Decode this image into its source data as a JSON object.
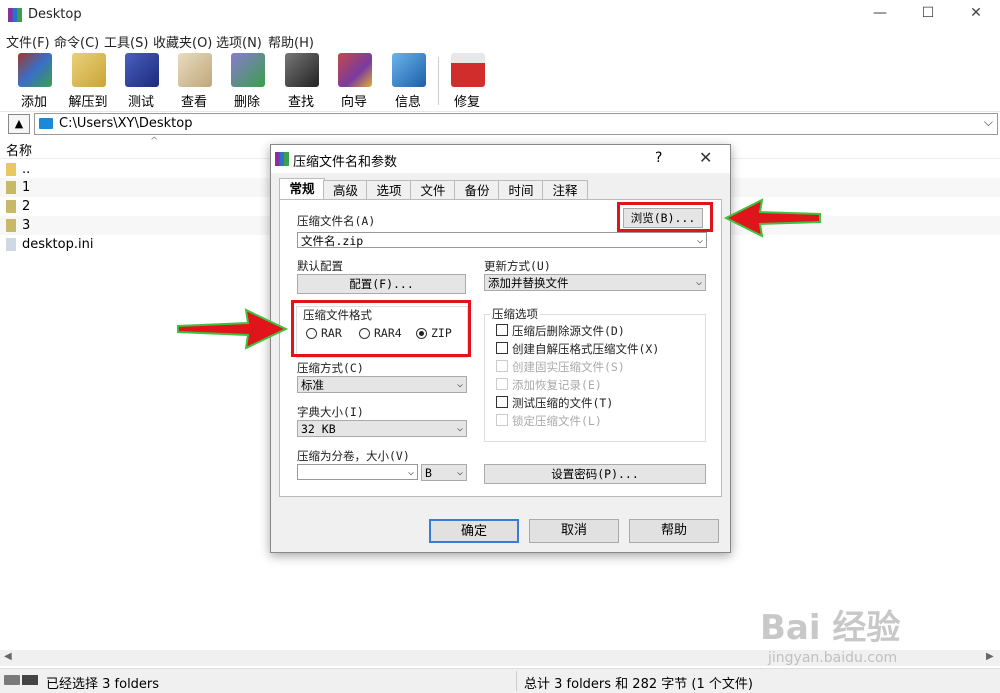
{
  "window": {
    "title": "Desktop",
    "min": "—",
    "max": "☐",
    "close": "✕"
  },
  "menu": [
    "文件(F)",
    "命令(C)",
    "工具(S)",
    "收藏夹(O)",
    "选项(N)",
    "帮助(H)"
  ],
  "toolbar": [
    {
      "label": "添加",
      "icon": "add-archive-icon",
      "color": "#9b3b2a"
    },
    {
      "label": "解压到",
      "icon": "extract-to-icon",
      "color": "#c9a535"
    },
    {
      "label": "测试",
      "icon": "test-icon",
      "color": "#2b3c9a"
    },
    {
      "label": "查看",
      "icon": "view-icon",
      "color": "#bfa77a"
    },
    {
      "label": "删除",
      "icon": "delete-icon",
      "color": "#6a5aa8"
    },
    {
      "label": "查找",
      "icon": "find-icon",
      "color": "#3b3b3b"
    },
    {
      "label": "向导",
      "icon": "wizard-icon",
      "color": "#7a3aa0"
    },
    {
      "label": "信息",
      "icon": "info-icon",
      "color": "#2e7ec8"
    },
    {
      "label": "修复",
      "icon": "repair-icon",
      "color": "#d22d2d"
    }
  ],
  "address": {
    "path": "C:\\Users\\XY\\Desktop"
  },
  "filelist": {
    "column_name": "名称",
    "items": [
      "..",
      "1",
      "2",
      "3",
      "desktop.ini"
    ]
  },
  "status": {
    "left": "已经选择 3 folders",
    "right": "总计 3 folders 和 282 字节 (1 个文件)"
  },
  "dialog": {
    "title": "压缩文件名和参数",
    "help": "?",
    "close": "✕",
    "tabs": [
      "常规",
      "高级",
      "选项",
      "文件",
      "备份",
      "时间",
      "注释"
    ],
    "archive_name_label": "压缩文件名(A)",
    "archive_name_value": "文件名.zip",
    "browse_button": "浏览(B)...",
    "default_profile_label": "默认配置",
    "profile_button": "配置(F)...",
    "update_mode_label": "更新方式(U)",
    "update_mode_value": "添加并替换文件",
    "format_label": "压缩文件格式",
    "formats": [
      "RAR",
      "RAR4",
      "ZIP"
    ],
    "selected_format": "ZIP",
    "options_label": "压缩选项",
    "options": [
      {
        "label": "压缩后删除源文件(D)",
        "enabled": true
      },
      {
        "label": "创建自解压格式压缩文件(X)",
        "enabled": true
      },
      {
        "label": "创建固实压缩文件(S)",
        "enabled": false
      },
      {
        "label": "添加恢复记录(E)",
        "enabled": false
      },
      {
        "label": "测试压缩的文件(T)",
        "enabled": true
      },
      {
        "label": "锁定压缩文件(L)",
        "enabled": false
      }
    ],
    "method_label": "压缩方式(C)",
    "method_value": "标准",
    "dict_label": "字典大小(I)",
    "dict_value": "32 KB",
    "split_label": "压缩为分卷，大小(V)",
    "split_value": "",
    "split_unit": "B",
    "password_button": "设置密码(P)...",
    "ok": "确定",
    "cancel": "取消",
    "help_button": "帮助"
  },
  "watermark": {
    "main": "Bai 经验",
    "sub": "jingyan.baidu.com"
  }
}
